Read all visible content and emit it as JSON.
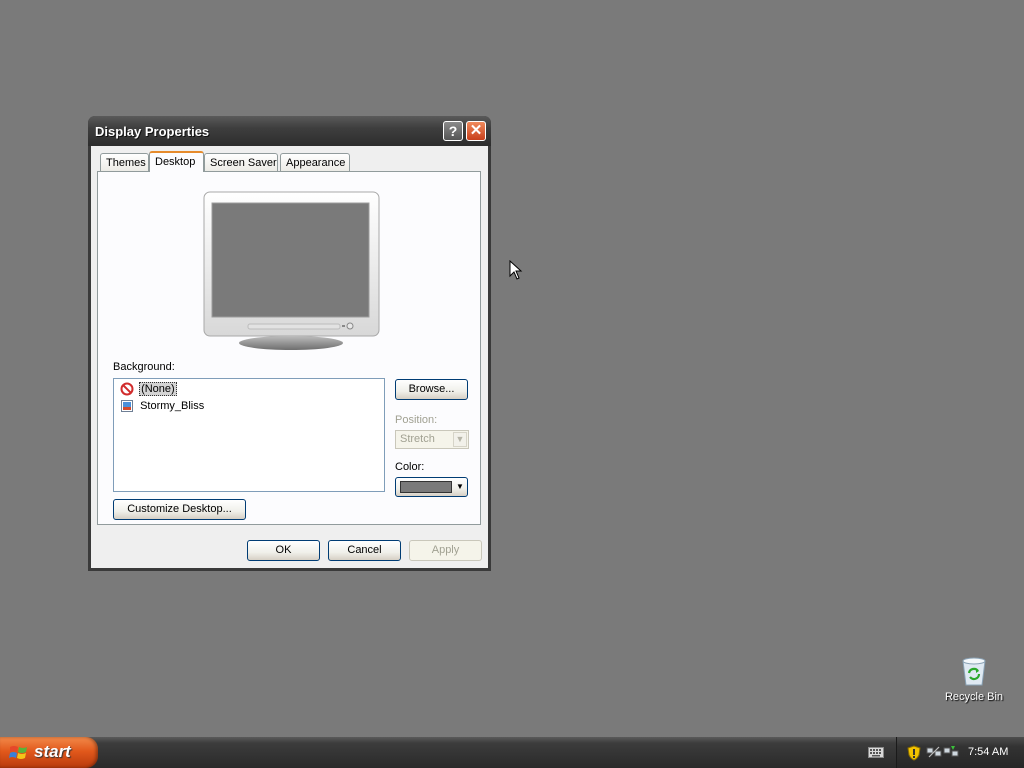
{
  "window": {
    "title": "Display Properties",
    "help_glyph": "?",
    "close_glyph": "✕"
  },
  "tabs": [
    {
      "label": "Themes",
      "active": false
    },
    {
      "label": "Desktop",
      "active": true
    },
    {
      "label": "Screen Saver",
      "active": false
    },
    {
      "label": "Appearance",
      "active": false
    }
  ],
  "desktop_tab": {
    "background_label": "Background:",
    "background_items": [
      {
        "label": "(None)",
        "icon": "no-symbol-icon",
        "selected": true
      },
      {
        "label": "Stormy_Bliss",
        "icon": "image-file-icon",
        "selected": false
      }
    ],
    "browse_label": "Browse...",
    "position_label": "Position:",
    "position_value": "Stretch",
    "color_label": "Color:",
    "color_value": "#7a7a7a",
    "customize_label": "Customize Desktop..."
  },
  "dialog_buttons": {
    "ok": "OK",
    "cancel": "Cancel",
    "apply": "Apply"
  },
  "desktop": {
    "background_color": "#7a7a7a",
    "icons": [
      {
        "label": "Recycle Bin",
        "icon": "recycle-bin-icon"
      }
    ]
  },
  "taskbar": {
    "start_label": "start",
    "clock": "7:54 AM",
    "tray_icons": [
      "keyboard-icon",
      "security-shield-icon",
      "network-disconnected-icon",
      "network-connection-icon"
    ]
  },
  "colors": {
    "start_button": "#e2591c",
    "taskbar": "#2a2a2a",
    "active_tab_accent": "#e68b2c",
    "close_button": "#c8401c"
  }
}
